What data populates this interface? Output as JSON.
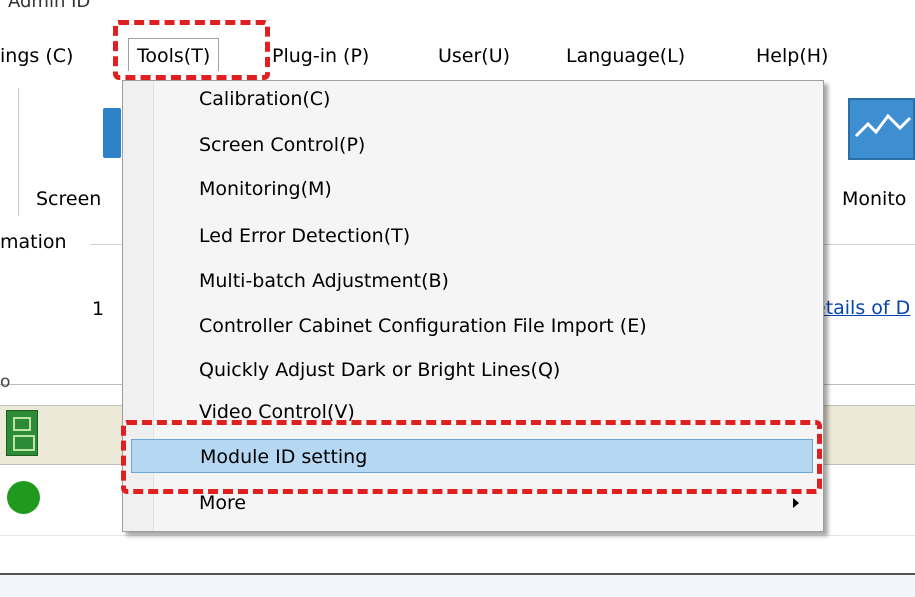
{
  "window": {
    "title_partial": "Admin ID"
  },
  "menubar": {
    "items": [
      {
        "label": "ings (C)"
      },
      {
        "label": "Tools(T)"
      },
      {
        "label": "Plug-in (P)"
      },
      {
        "label": "User(U)"
      },
      {
        "label": "Language(L)"
      },
      {
        "label": "Help(H)"
      }
    ]
  },
  "toolbar": {
    "left_label": "Screen",
    "right_label": "Monito"
  },
  "info": {
    "group_label": "mation",
    "count": "1",
    "details_link": "etails of D"
  },
  "tools_menu": {
    "items": [
      {
        "label": "Calibration(C)"
      },
      {
        "label": "Screen Control(P)"
      },
      {
        "label": "Monitoring(M)"
      },
      {
        "label": "Led Error Detection(T)"
      },
      {
        "label": "Multi-batch Adjustment(B)"
      },
      {
        "label": "Controller Cabinet Configuration File Import (E)"
      },
      {
        "label": "Quickly Adjust Dark or Bright Lines(Q)"
      },
      {
        "label": "Video Control(V)"
      },
      {
        "label": "Module ID setting"
      },
      {
        "label": "More"
      }
    ],
    "highlighted_item": "Module ID setting"
  },
  "colors": {
    "highlight": "#b6d7f2",
    "annotation": "#e02020",
    "status_ok": "#1f9a1f",
    "link": "#0645ad"
  },
  "icons": [
    "screen-icon",
    "monitor-icon",
    "chip-icon",
    "status-dot-icon",
    "submenu-arrow-icon"
  ]
}
